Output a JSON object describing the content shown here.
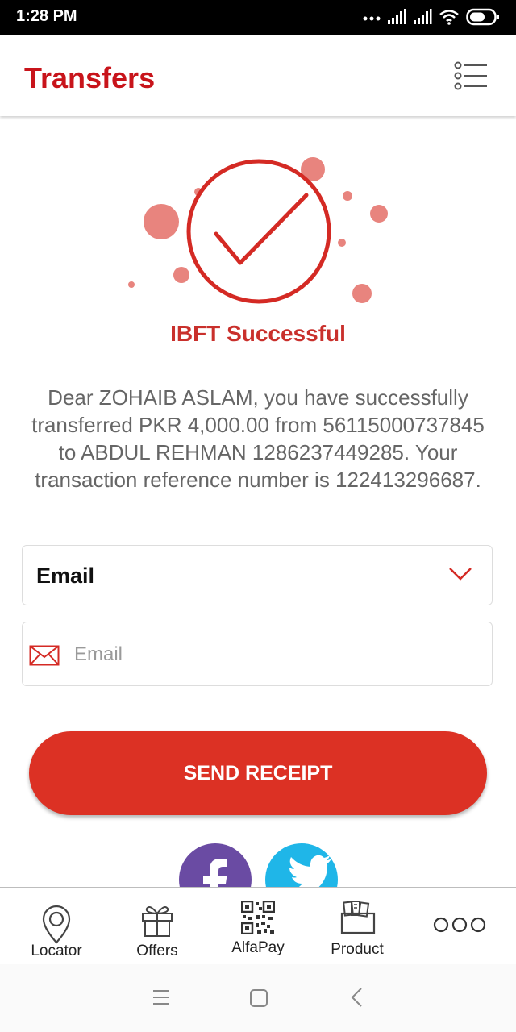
{
  "status_bar": {
    "time": "1:28 PM",
    "icons": [
      "dots-icon",
      "signal-icon",
      "signal-icon",
      "wifi-icon",
      "battery-icon"
    ]
  },
  "header": {
    "title": "Transfers",
    "menu_icon": "list-menu-icon"
  },
  "result": {
    "icon": "success-check-icon",
    "title": "IBFT Successful",
    "message": "Dear ZOHAIB ASLAM, you have successfully transferred PKR 4,000.00 from 56115000737845 to ABDUL REHMAN 1286237449285. Your transaction reference number is 122413296687."
  },
  "receipt_form": {
    "delivery_method": {
      "selected": "Email",
      "icon": "chevron-down-icon"
    },
    "email_input": {
      "value": "",
      "placeholder": "Email",
      "icon": "envelope-icon"
    },
    "send_button_label": "SEND RECEIPT"
  },
  "share": {
    "items": [
      {
        "name": "facebook",
        "icon": "facebook-icon",
        "color": "#6a4ba3"
      },
      {
        "name": "twitter",
        "icon": "twitter-icon",
        "color": "#1fb6e8"
      }
    ]
  },
  "bottom_nav": {
    "items": [
      {
        "label": "Locator",
        "icon": "location-pin-icon"
      },
      {
        "label": "Offers",
        "icon": "gift-icon"
      },
      {
        "label": "AlfaPay",
        "icon": "qr-code-icon"
      },
      {
        "label": "Product",
        "icon": "product-cards-icon"
      },
      {
        "label": "",
        "icon": "more-icon"
      }
    ]
  },
  "system_nav": {
    "icons": [
      "menu-icon",
      "home-icon",
      "back-icon"
    ]
  },
  "colors": {
    "brand_red": "#c8141b",
    "button_red": "#dc3124",
    "success_red": "#c9302c",
    "bubble_pink": "#e8847e",
    "text_gray": "#666666"
  }
}
